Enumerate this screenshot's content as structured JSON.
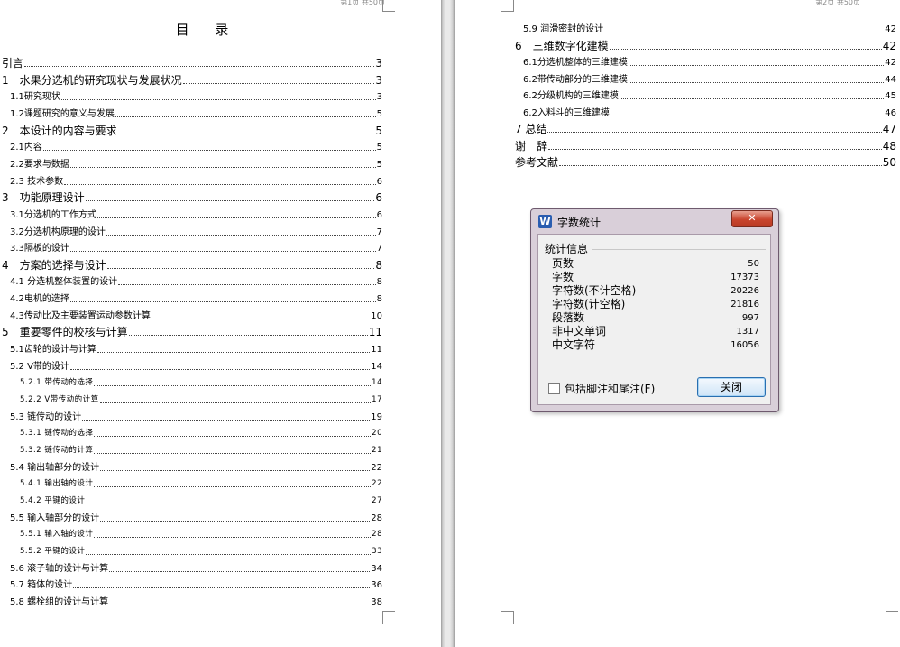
{
  "left_page": {
    "header": "第1页    共50页",
    "title": "目 录",
    "entries": [
      {
        "label": "引言",
        "page": "3",
        "level": 1
      },
      {
        "label": "1　水果分选机的研究现状与发展状况",
        "page": "3",
        "level": 1
      },
      {
        "label": "1.1研究现状",
        "page": "3",
        "level": 2
      },
      {
        "label": "1.2课题研究的意义与发展",
        "page": "5",
        "level": 2
      },
      {
        "label": "2　本设计的内容与要求",
        "page": "5",
        "level": 1
      },
      {
        "label": "2.1内容",
        "page": "5",
        "level": 2
      },
      {
        "label": "2.2要求与数据",
        "page": "5",
        "level": 2
      },
      {
        "label": "2.3 技术参数",
        "page": "6",
        "level": 2
      },
      {
        "label": "3　功能原理设计",
        "page": "6",
        "level": 1
      },
      {
        "label": "3.1分选机的工作方式",
        "page": "6",
        "level": 2
      },
      {
        "label": "3.2分选机构原理的设计",
        "page": "7",
        "level": 2
      },
      {
        "label": "3.3隔板的设计",
        "page": "7",
        "level": 2
      },
      {
        "label": "4　方案的选择与设计",
        "page": "8",
        "level": 1
      },
      {
        "label": "4.1 分选机整体装置的设计",
        "page": "8",
        "level": 2
      },
      {
        "label": "4.2电机的选择",
        "page": "8",
        "level": 2
      },
      {
        "label": "4.3传动比及主要装置运动参数计算",
        "page": "10",
        "level": 2
      },
      {
        "label": "5　重要零件的校核与计算",
        "page": "11",
        "level": 1
      },
      {
        "label": "5.1齿轮的设计与计算",
        "page": "11",
        "level": 2
      },
      {
        "label": "5.2 V带的设计",
        "page": "14",
        "level": 2
      },
      {
        "label": "5.2.1 带传动的选择",
        "page": "14",
        "level": 3
      },
      {
        "label": "5.2.2 V带传动的计算",
        "page": "17",
        "level": 3
      },
      {
        "label": "5.3 链传动的设计",
        "page": "19",
        "level": 2
      },
      {
        "label": "5.3.1 链传动的选择",
        "page": "20",
        "level": 3
      },
      {
        "label": "5.3.2 链传动的计算",
        "page": "21",
        "level": 3
      },
      {
        "label": "5.4 输出轴部分的设计",
        "page": "22",
        "level": 2
      },
      {
        "label": "5.4.1 输出轴的设计",
        "page": "22",
        "level": 3
      },
      {
        "label": "5.4.2 平键的设计",
        "page": "27",
        "level": 3
      },
      {
        "label": "5.5 输入轴部分的设计",
        "page": "28",
        "level": 2
      },
      {
        "label": "5.5.1 输入轴的设计",
        "page": "28",
        "level": 3
      },
      {
        "label": "5.5.2 平键的设计",
        "page": "33",
        "level": 3
      },
      {
        "label": "5.6 滚子轴的设计与计算",
        "page": "34",
        "level": 2
      },
      {
        "label": "5.7 箱体的设计",
        "page": "36",
        "level": 2
      },
      {
        "label": "5.8 螺栓组的设计与计算",
        "page": "38",
        "level": 2
      }
    ]
  },
  "right_page": {
    "header": "第2页    共50页",
    "entries": [
      {
        "label": "5.9 润滑密封的设计",
        "page": "42",
        "level": 2
      },
      {
        "label": "6　三维数字化建模",
        "page": "42",
        "level": 1
      },
      {
        "label": "6.1分选机整体的三维建模",
        "page": "42",
        "level": 2
      },
      {
        "label": "6.2带传动部分的三维建模",
        "page": "44",
        "level": 2
      },
      {
        "label": "6.2分级机构的三维建模",
        "page": "45",
        "level": 2
      },
      {
        "label": "6.2入料斗的三维建模",
        "page": "46",
        "level": 2
      },
      {
        "label": "7 总结",
        "page": "47",
        "level": 1
      },
      {
        "label": "谢　辞",
        "page": "48",
        "level": 1
      },
      {
        "label": "参考文献",
        "page": "50",
        "level": 1
      }
    ]
  },
  "dialog": {
    "icon_label": "W",
    "icon": "wps-writer-icon",
    "title": "字数统计",
    "close_label": "✕",
    "group_label": "统计信息",
    "stats": [
      {
        "key": "页数",
        "value": "50"
      },
      {
        "key": "字数",
        "value": "17373"
      },
      {
        "key": "字符数(不计空格)",
        "value": "20226"
      },
      {
        "key": "字符数(计空格)",
        "value": "21816"
      },
      {
        "key": "段落数",
        "value": "997"
      },
      {
        "key": "非中文单词",
        "value": "1317"
      },
      {
        "key": "中文字符",
        "value": "16056"
      }
    ],
    "checkbox_label": "包括脚注和尾注(F)",
    "checkbox_checked": false,
    "ok_label": "关闭"
  },
  "colors": {
    "dialog_frame": "#d9cfd9",
    "close_button": "#c9452e",
    "wps_blue": "#2a5db0"
  }
}
